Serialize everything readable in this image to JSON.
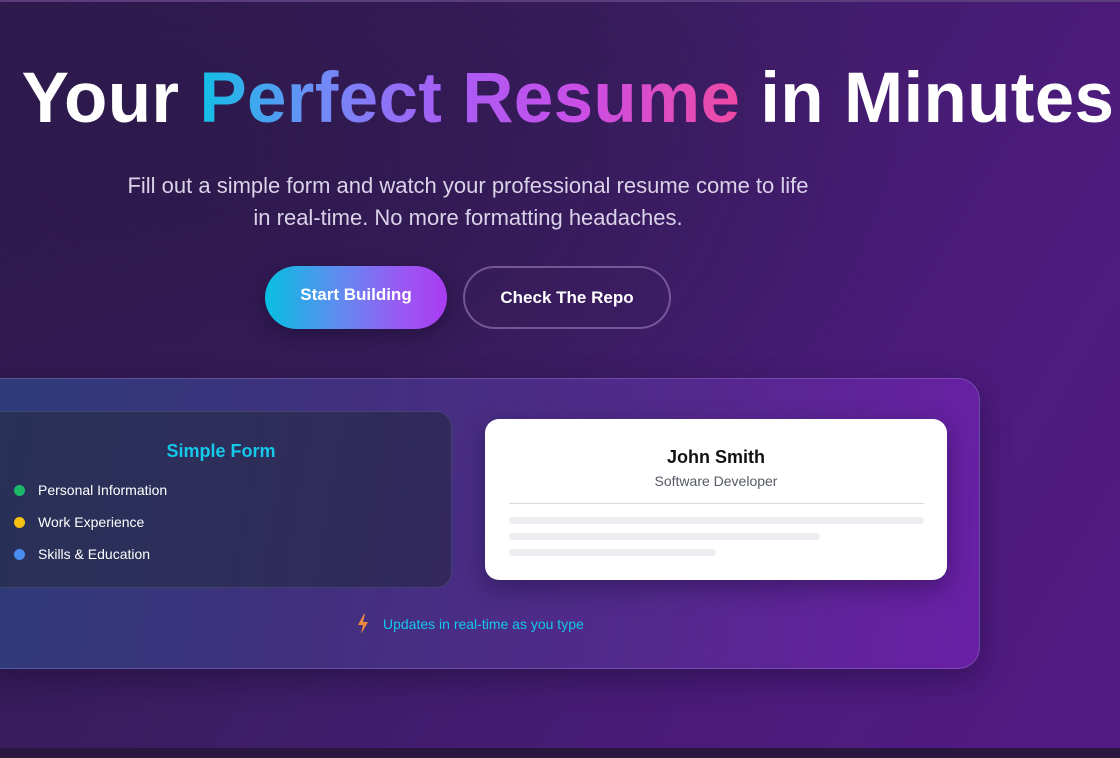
{
  "hero": {
    "title_part1": "Your ",
    "title_highlight": "Perfect Resume",
    "title_part2": " in Minutes",
    "subtitle_line1": "Fill out a simple form and watch your professional resume come to life",
    "subtitle_line2": "in real-time. No more formatting headaches."
  },
  "actions": {
    "primary_label": "Start Building",
    "secondary_label": "Check The Repo"
  },
  "demo": {
    "form": {
      "title": "Simple Form",
      "items": [
        {
          "label": "Personal Information",
          "color": "#1db96b"
        },
        {
          "label": "Work Experience",
          "color": "#f5c211"
        },
        {
          "label": "Skills & Education",
          "color": "#4a8df0"
        }
      ]
    },
    "resume": {
      "name": "John Smith",
      "role": "Software Developer"
    },
    "update_text": "Updates in real-time as you type",
    "bolt_icon": "lightning-icon"
  },
  "colors": {
    "accent_cyan": "#14c8ea",
    "bolt": "#f08a3a"
  }
}
